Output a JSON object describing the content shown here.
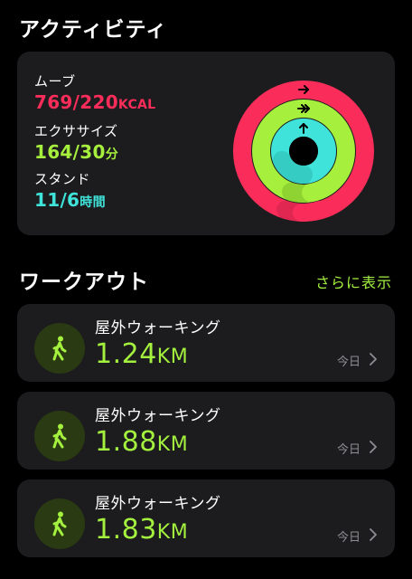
{
  "activity": {
    "title": "アクティビティ",
    "move": {
      "label": "ムーブ",
      "current": "769",
      "goal": "220",
      "unit": "KCAL",
      "color": "#fa2d5a",
      "progress": 3.5
    },
    "exercise": {
      "label": "エクササイズ",
      "current": "164",
      "goal": "30",
      "unit": "分",
      "color": "#a6f03d",
      "progress": 5.47
    },
    "stand": {
      "label": "スタンド",
      "current": "11",
      "goal": "6",
      "unit": "時間",
      "color": "#3fe3d9",
      "progress": 1.83
    }
  },
  "workouts": {
    "title": "ワークアウト",
    "see_more": "さらに表示",
    "items": [
      {
        "name": "屋外ウォーキング",
        "distance": "1.24",
        "unit": "KM",
        "date": "今日",
        "icon": "walking-figure-icon"
      },
      {
        "name": "屋外ウォーキング",
        "distance": "1.88",
        "unit": "KM",
        "date": "今日",
        "icon": "walking-figure-icon"
      },
      {
        "name": "屋外ウォーキング",
        "distance": "1.83",
        "unit": "KM",
        "date": "今日",
        "icon": "walking-figure-icon"
      }
    ]
  },
  "colors": {
    "accent": "#a4f03e",
    "card": "#1c1c1e",
    "background": "#000000"
  }
}
